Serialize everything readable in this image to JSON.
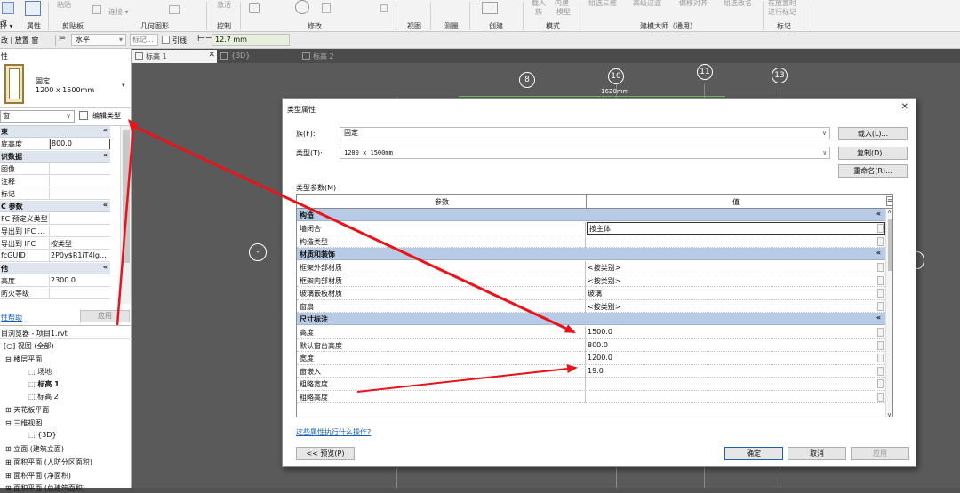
{
  "ribbon": {
    "left_labels": [
      "改",
      "择 ▾",
      "属性",
      "剪贴板",
      "粘贴",
      "连接 ▾",
      "几何图形",
      "激活",
      "控制",
      "修改",
      "视图",
      "测量",
      "创建",
      "模式"
    ],
    "faded_labels": [
      "载入",
      "内建",
      "族",
      "模型",
      "组选三维",
      "高级过滤",
      "偏移对齐",
      "组选改名",
      "在放置时",
      "进行标记"
    ],
    "group_labels": {
      "clipboard": "剪贴板",
      "geometry": "几何图形",
      "control": "控制",
      "modify": "修改",
      "view": "视图",
      "measure": "测量",
      "create": "创建",
      "mode": "模式",
      "master": "建模大师（通用）",
      "tag": "标记"
    }
  },
  "optionbar": {
    "context": "改 | 放置 窗",
    "orientation": "水平",
    "tag": "标记...",
    "leader": "引线",
    "length": "12.7 mm"
  },
  "view_tabs": [
    {
      "label": "标高 1",
      "active": true
    },
    {
      "label": "{3D}",
      "active": false
    },
    {
      "label": "标高 2",
      "active": false
    }
  ],
  "properties": {
    "panel_title": "性",
    "family_name": "固定",
    "type_name": "1200 x 1500mm",
    "category": "窗",
    "edit_type": "编辑类型",
    "sections": [
      {
        "name": "束",
        "rows": [
          {
            "k": "底高度",
            "v": "800.0"
          }
        ]
      },
      {
        "name": "识数据",
        "rows": [
          {
            "k": "图像",
            "v": ""
          },
          {
            "k": "注释",
            "v": ""
          },
          {
            "k": "标记",
            "v": ""
          }
        ]
      },
      {
        "name": "C 参数",
        "rows": [
          {
            "k": "FC 预定义类型",
            "v": ""
          },
          {
            "k": "导出到 IFC ...",
            "v": ""
          },
          {
            "k": "导出到 IFC",
            "v": "按类型"
          },
          {
            "k": "fcGUID",
            "v": "2P0y$R1iT4lg..."
          }
        ]
      },
      {
        "name": "他",
        "rows": [
          {
            "k": "高度",
            "v": "2300.0"
          },
          {
            "k": "防火等级",
            "v": ""
          }
        ]
      }
    ],
    "help_link": "性帮助",
    "apply": "应用"
  },
  "browser": {
    "title": "目浏览器 - 项目1.rvt",
    "items": [
      {
        "label": "视图 (全部)",
        "indent": 0
      },
      {
        "label": "楼层平面",
        "indent": 1
      },
      {
        "label": "场地",
        "indent": 2
      },
      {
        "label": "标高 1",
        "indent": 2,
        "bold": true
      },
      {
        "label": "标高 2",
        "indent": 2
      },
      {
        "label": "天花板平面",
        "indent": 1
      },
      {
        "label": "三维视图",
        "indent": 1
      },
      {
        "label": "{3D}",
        "indent": 2
      },
      {
        "label": "立面 (建筑立面)",
        "indent": 1
      },
      {
        "label": "面积平面 (人防分区面积)",
        "indent": 1
      },
      {
        "label": "面积平面 (净面积)",
        "indent": 1
      },
      {
        "label": "面积平面 (总建筑面积)",
        "indent": 1
      }
    ]
  },
  "canvas": {
    "grid_bubbles": [
      "8",
      "10",
      "11",
      "13"
    ],
    "dim_text": "1620mm",
    "left_bubble": "-"
  },
  "dialog": {
    "title": "类型属性",
    "family_label": "族(F):",
    "family_value": "固定",
    "type_label": "类型(T):",
    "type_value": "1200 x 1500mm",
    "load_btn": "载入(L)...",
    "copy_btn": "复制(D)...",
    "rename_btn": "重命名(R)...",
    "params_label": "类型参数(M)",
    "col_param": "参数",
    "col_value": "值",
    "sections": [
      {
        "name": "构造",
        "rows": [
          {
            "k": "墙闭合",
            "v": "按主体",
            "boxed": true
          },
          {
            "k": "构造类型",
            "v": ""
          }
        ]
      },
      {
        "name": "材质和装饰",
        "rows": [
          {
            "k": "框架外部材质",
            "v": "<按类别>"
          },
          {
            "k": "框架内部材质",
            "v": "<按类别>"
          },
          {
            "k": "玻璃嵌板材质",
            "v": "玻璃"
          },
          {
            "k": "窗扇",
            "v": "<按类别>"
          }
        ]
      },
      {
        "name": "尺寸标注",
        "rows": [
          {
            "k": "高度",
            "v": "1500.0"
          },
          {
            "k": "默认窗台高度",
            "v": "800.0"
          },
          {
            "k": "宽度",
            "v": "1200.0"
          },
          {
            "k": "窗嵌入",
            "v": "19.0"
          },
          {
            "k": "粗略宽度",
            "v": ""
          },
          {
            "k": "粗略高度",
            "v": ""
          }
        ]
      }
    ],
    "help_link": "这些属性执行什么操作?",
    "preview_btn": "<< 预览(P)",
    "ok_btn": "确定",
    "cancel_btn": "取消",
    "apply_btn": "应用"
  },
  "colors": {
    "arrow": "#e8141c",
    "section_bg": "#b8cbe6",
    "accent": "#3366cc"
  }
}
